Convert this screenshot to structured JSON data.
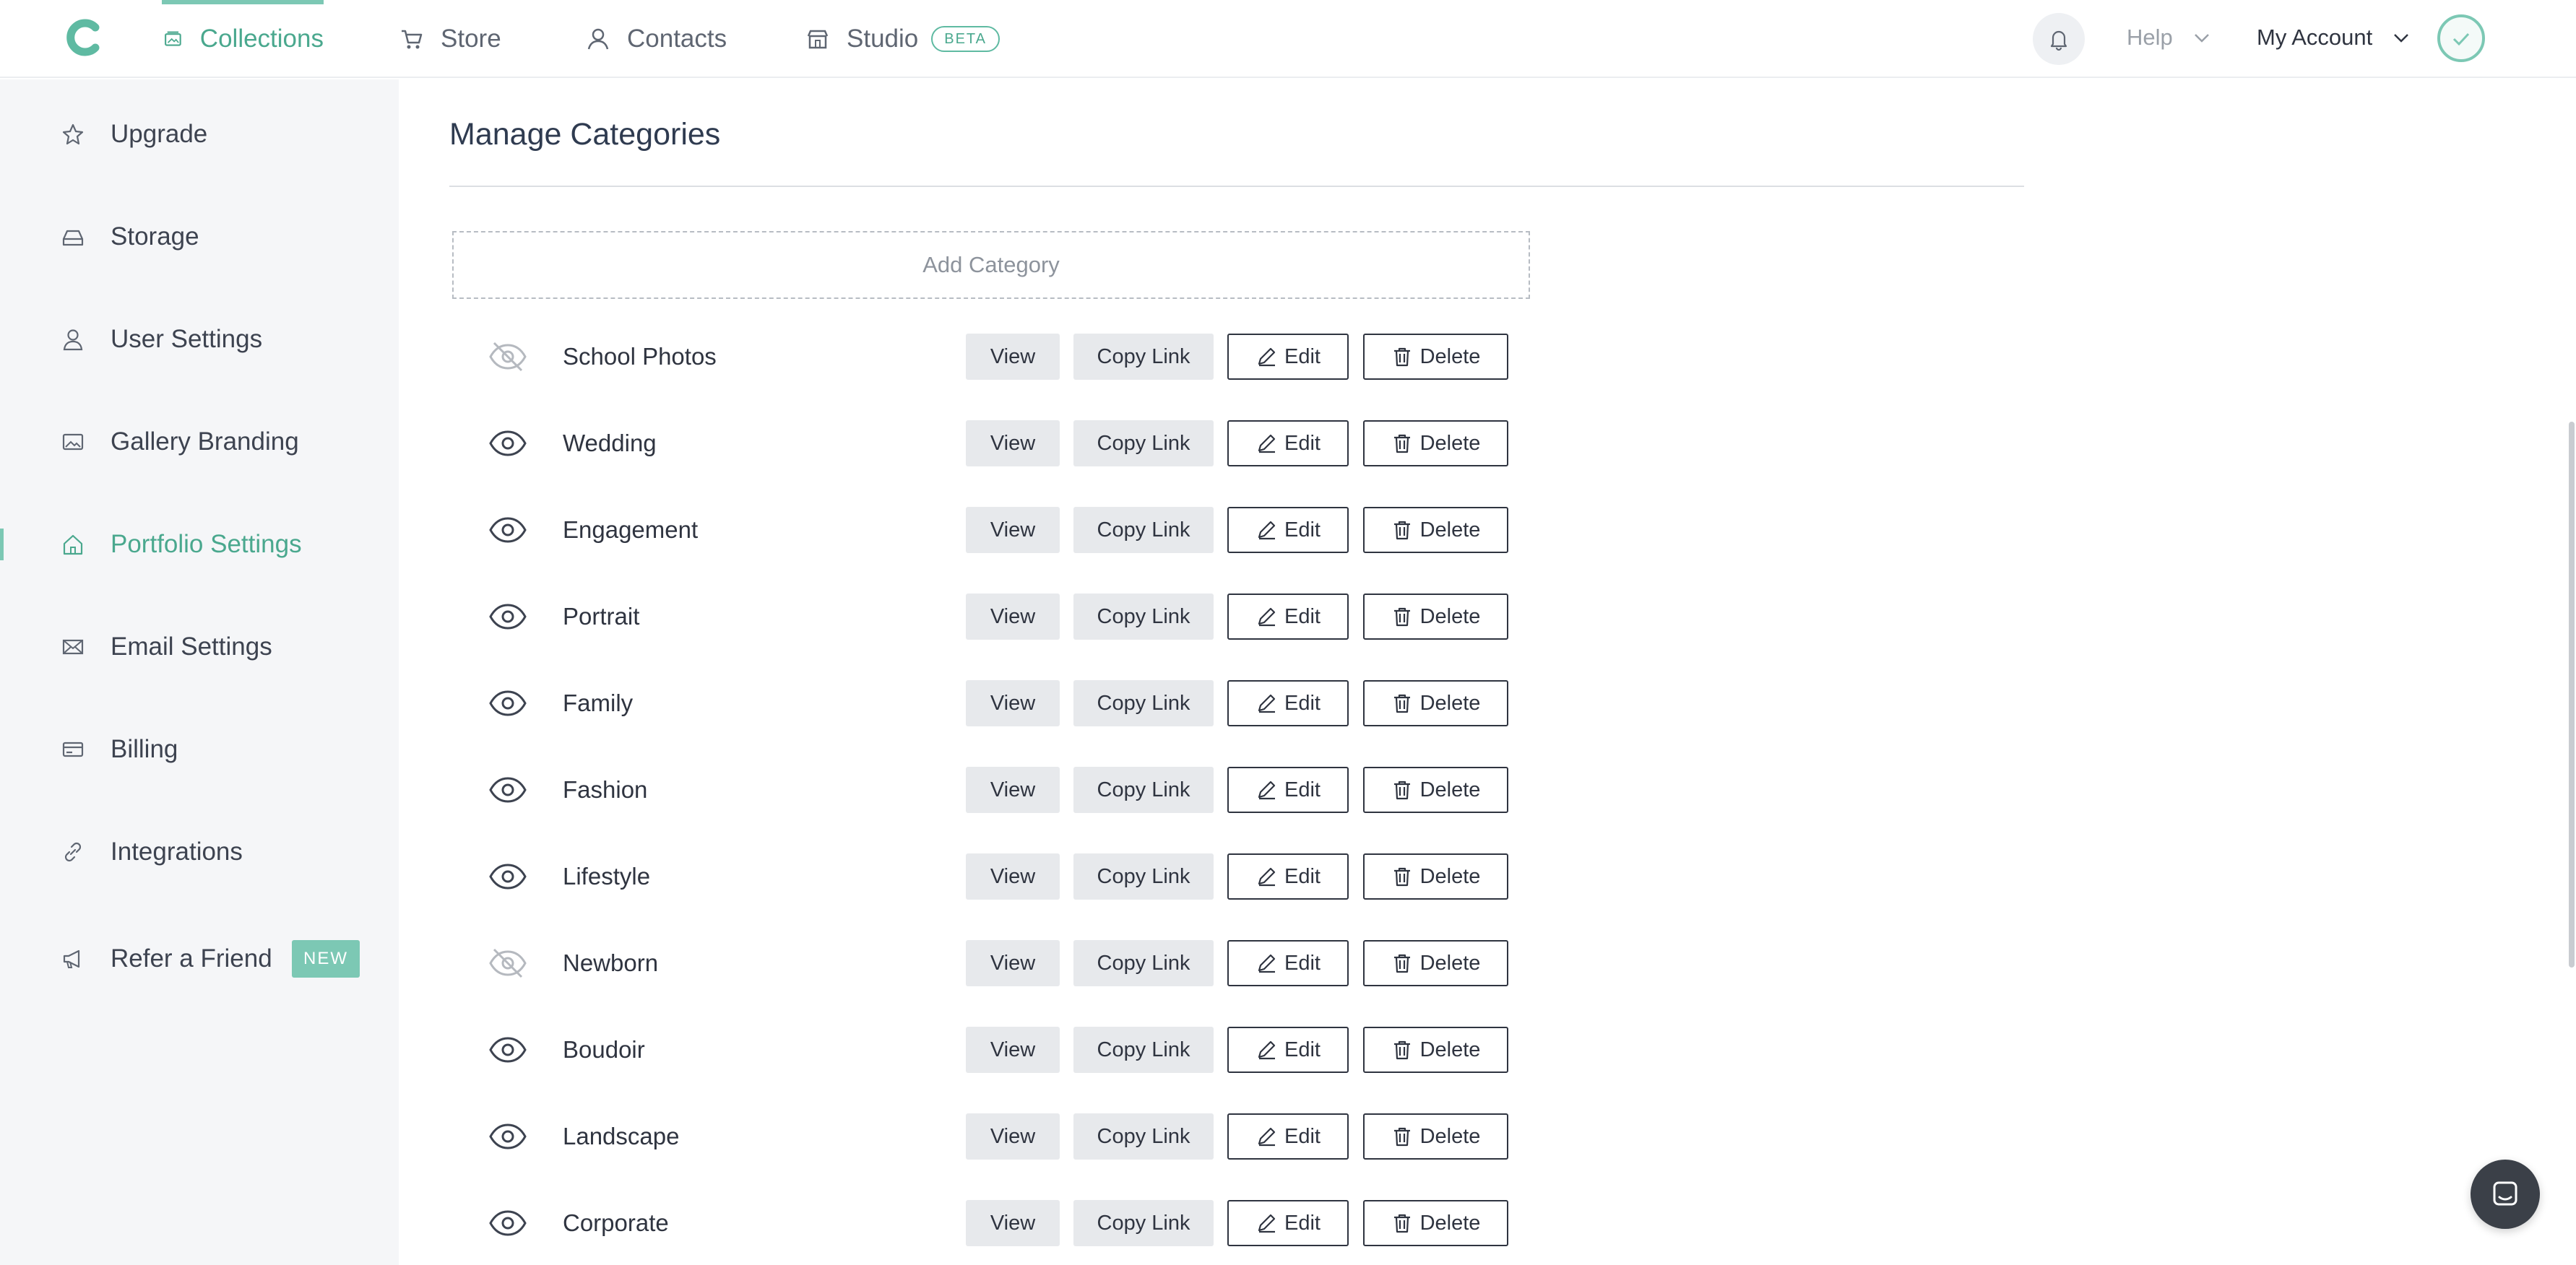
{
  "colors": {
    "accent": "#7cc8b4",
    "accent_text": "#4aa88e",
    "sidebar_bg": "#f5f6f8",
    "button_gray": "#e7e9ec"
  },
  "nav": {
    "logo_icon": "capture-logo",
    "items": [
      {
        "label": "Collections",
        "icon": "collections-icon",
        "active": true
      },
      {
        "label": "Store",
        "icon": "cart-icon",
        "active": false
      },
      {
        "label": "Contacts",
        "icon": "person-icon",
        "active": false
      },
      {
        "label": "Studio",
        "icon": "studio-icon",
        "badge": "BETA",
        "active": false
      }
    ],
    "help_label": "Help",
    "account_label": "My Account"
  },
  "sidebar": {
    "items": [
      {
        "label": "Upgrade",
        "icon": "star-icon"
      },
      {
        "label": "Storage",
        "icon": "storage-icon"
      },
      {
        "label": "User Settings",
        "icon": "user-icon"
      },
      {
        "label": "Gallery Branding",
        "icon": "image-icon"
      },
      {
        "label": "Portfolio Settings",
        "icon": "home-icon",
        "active": true
      },
      {
        "label": "Email Settings",
        "icon": "mail-icon"
      },
      {
        "label": "Billing",
        "icon": "card-icon"
      },
      {
        "label": "Integrations",
        "icon": "link-icon"
      },
      {
        "label": "Refer a Friend",
        "icon": "megaphone-icon",
        "badge": "NEW"
      }
    ]
  },
  "main": {
    "title": "Manage Categories",
    "add_category_label": "Add Category",
    "buttons": {
      "view": "View",
      "copy_link": "Copy Link",
      "edit": "Edit",
      "delete": "Delete"
    },
    "categories": [
      {
        "name": "School Photos",
        "visible": false
      },
      {
        "name": "Wedding",
        "visible": true
      },
      {
        "name": "Engagement",
        "visible": true
      },
      {
        "name": "Portrait",
        "visible": true
      },
      {
        "name": "Family",
        "visible": true
      },
      {
        "name": "Fashion",
        "visible": true
      },
      {
        "name": "Lifestyle",
        "visible": true
      },
      {
        "name": "Newborn",
        "visible": false
      },
      {
        "name": "Boudoir",
        "visible": true
      },
      {
        "name": "Landscape",
        "visible": true
      },
      {
        "name": "Corporate",
        "visible": true
      }
    ]
  }
}
